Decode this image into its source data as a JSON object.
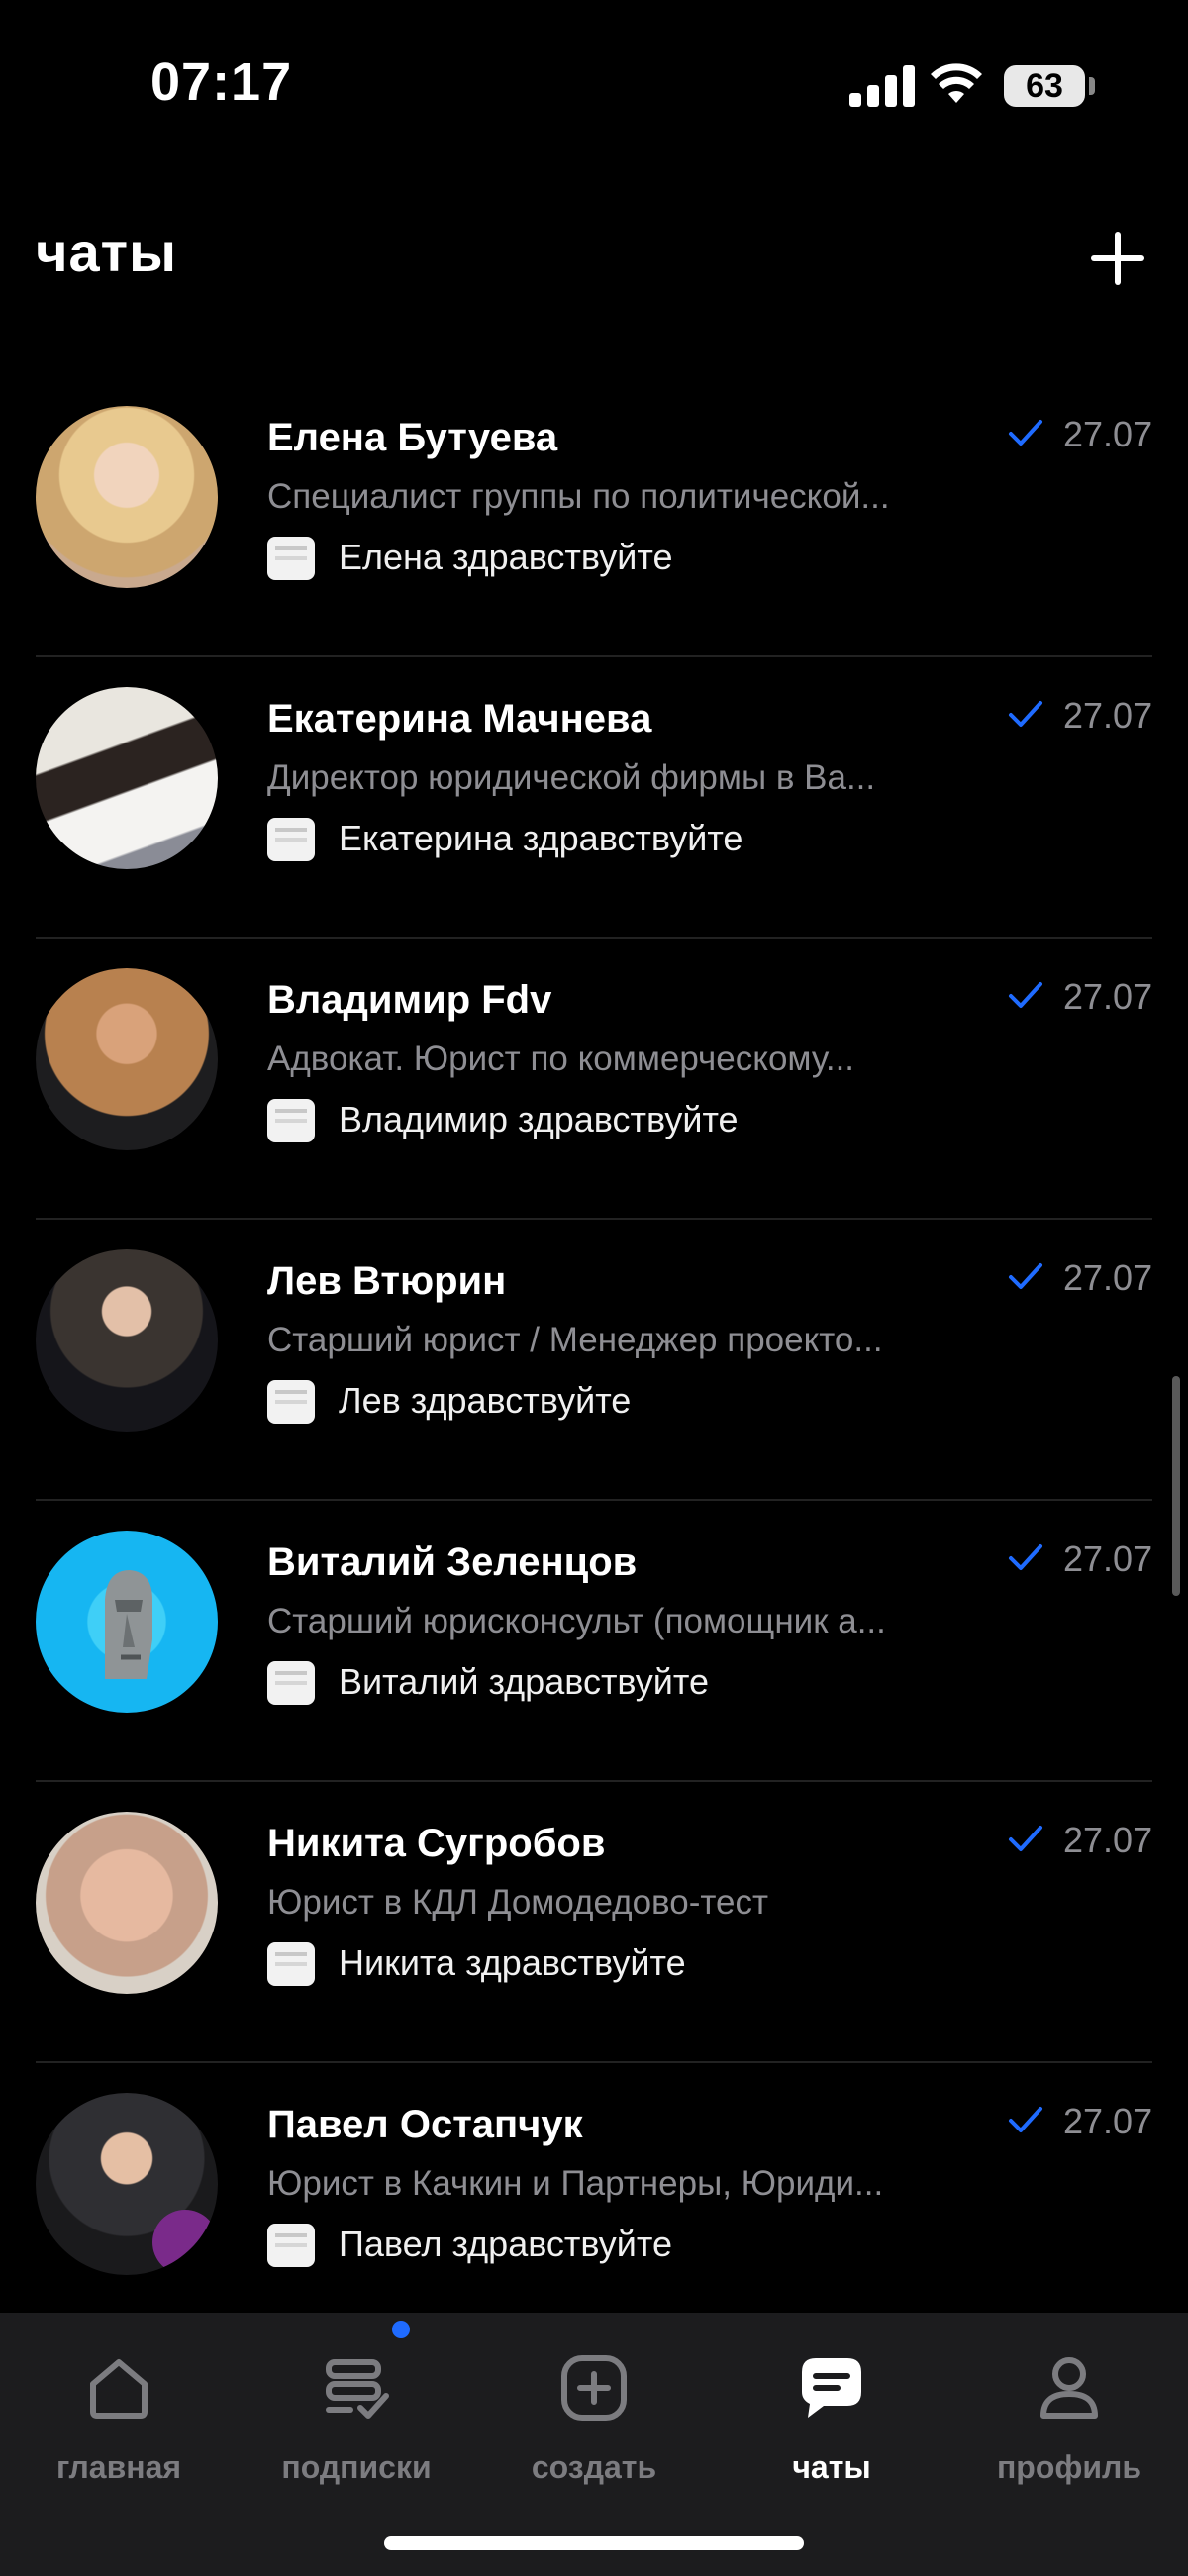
{
  "status_bar": {
    "time": "07:17",
    "battery": "63"
  },
  "header": {
    "title": "чаты",
    "add_icon": "plus-icon"
  },
  "chats": [
    {
      "name": "Елена Бутуева",
      "subtitle": "Специалист группы по политической...",
      "preview": "Елена здравствуйте",
      "date": "27.07",
      "avatar_color": "#c9a98e"
    },
    {
      "name": "Екатерина Мачнева",
      "subtitle": "Директор юридической фирмы в Ва...",
      "preview": "Екатерина здравствуйте",
      "date": "27.07",
      "avatar_color": "#d7d2c8"
    },
    {
      "name": "Владимир Fdv",
      "subtitle": "Адвокат. Юрист по коммерческому...",
      "preview": "Владимир здравствуйте",
      "date": "27.07",
      "avatar_color": "#b8814f"
    },
    {
      "name": "Лев Втюрин",
      "subtitle": "Старший юрист / Менеджер проекто...",
      "preview": "Лев здравствуйте",
      "date": "27.07",
      "avatar_color": "#3a3430"
    },
    {
      "name": "Виталий Зеленцов",
      "subtitle": "Старший юрисконсульт (помощник а...",
      "preview": "Виталий здравствуйте",
      "date": "27.07",
      "avatar_color": "#16b6f2"
    },
    {
      "name": "Никита Сугробов",
      "subtitle": "Юрист в КДЛ Домодедово-тест",
      "preview": "Никита здравствуйте",
      "date": "27.07",
      "avatar_color": "#c7a08a"
    },
    {
      "name": "Павел Остапчук",
      "subtitle": "Юрист в Качкин и Партнеры, Юриди...",
      "preview": "Павел здравствуйте",
      "date": "27.07",
      "avatar_color": "#2f2f33"
    }
  ],
  "tabs": [
    {
      "label": "главная",
      "icon": "home-icon",
      "active": false
    },
    {
      "label": "подписки",
      "icon": "subscriptions-icon",
      "active": false
    },
    {
      "label": "создать",
      "icon": "create-icon",
      "active": false
    },
    {
      "label": "чаты",
      "icon": "chat-icon",
      "active": true
    },
    {
      "label": "профиль",
      "icon": "profile-icon",
      "active": false
    }
  ],
  "colors": {
    "background": "#000000",
    "accent": "#1f6bff",
    "muted": "#8e8e93",
    "tabbar": "#1c1c1e"
  }
}
